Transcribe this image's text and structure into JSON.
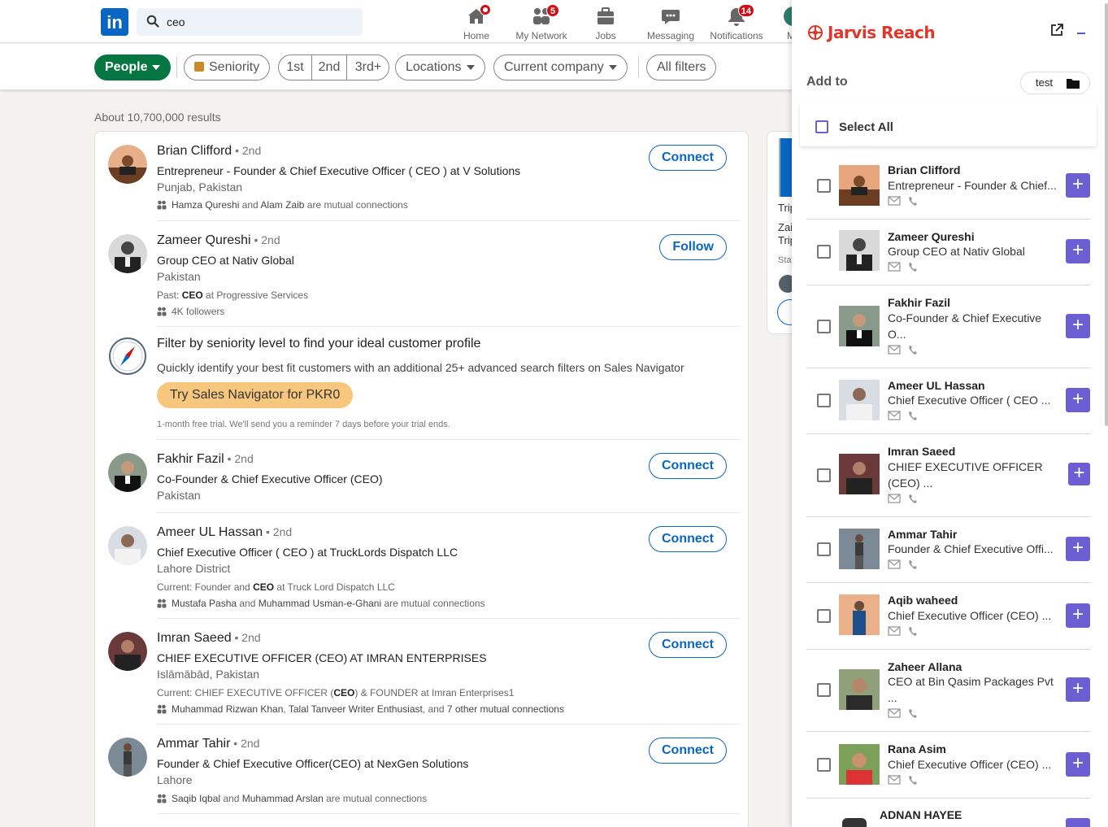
{
  "nav": {
    "search_value": "ceo",
    "items": [
      {
        "label": "Home",
        "icon": "home-icon",
        "badge": ""
      },
      {
        "label": "My Network",
        "icon": "network-icon",
        "badge": "5"
      },
      {
        "label": "Jobs",
        "icon": "briefcase-icon",
        "badge": ""
      },
      {
        "label": "Messaging",
        "icon": "messaging-icon",
        "badge": ""
      },
      {
        "label": "Notifications",
        "icon": "bell-icon",
        "badge": "14"
      }
    ],
    "cut_label": "M"
  },
  "filters": {
    "people": "People",
    "seniority": "Seniority",
    "deg1": "1st",
    "deg2": "2nd",
    "deg3": "3rd+",
    "locations": "Locations",
    "current_company": "Current company",
    "all_filters": "All filters"
  },
  "results": {
    "count": "About 10,700,000 results",
    "items": [
      {
        "name": "Brian Clifford",
        "degree": " • 2nd",
        "headline": "Entrepreneur - Founder & Chief Executive Officer ( CEO ) at V Solutions",
        "location": "Punjab, Pakistan",
        "extra": "",
        "mutual_a": "Hamza Qureshi",
        "mutual_mid": " and ",
        "mutual_b": "Alam Zaib",
        "mutual_end": " are mutual connections",
        "action": "Connect"
      },
      {
        "name": "Zameer Qureshi",
        "degree": " • 2nd",
        "headline": "Group CEO at Nativ Global",
        "location": "Pakistan",
        "past_pre": "Past: ",
        "past_bold": "CEO",
        "past_post": " at Progressive Services",
        "followers": "4K followers",
        "action": "Follow"
      },
      {
        "name": "Fakhir Fazil",
        "degree": " • 2nd",
        "headline": "Co-Founder & Chief Executive Officer (CEO)",
        "location": "Pakistan",
        "action": "Connect"
      },
      {
        "name": "Ameer UL Hassan",
        "degree": " • 2nd",
        "headline": "Chief Executive Officer ( CEO ) at TruckLords Dispatch LLC",
        "location": "Lahore District",
        "cur_pre": "Current: Founder and ",
        "cur_bold": "CEO",
        "cur_post": " at Truck Lord Dispatch LLC",
        "mutual_a": "Mustafa Pasha",
        "mutual_mid": " and ",
        "mutual_b": "Muhammad Usman-e-Ghani",
        "mutual_end": " are mutual connections",
        "action": "Connect"
      },
      {
        "name": "Imran Saeed",
        "degree": " • 2nd",
        "headline": "CHIEF EXECUTIVE OFFICER (CEO) AT IMRAN ENTERPRISES",
        "location": "Islāmābād, Pakistan",
        "cur_pre": "Current: CHIEF EXECUTIVE OFFICER (",
        "cur_bold": "CEO",
        "cur_post": ") & FOUNDER at Imran Enterprises1",
        "mutual_a": "Muhammad Rizwan Khan",
        "mutual_mid": ", ",
        "mutual_b": "Talal Tanveer Writer Enthusiast",
        "mutual_end": ", and ",
        "mutual_c": "7 other mutual connections",
        "action": "Connect"
      },
      {
        "name": "Ammar Tahir",
        "degree": " • 2nd",
        "headline": "Founder & Chief Executive Officer(CEO) at NexGen Solutions",
        "location": "Lahore",
        "mutual_a": "Saqib Iqbal",
        "mutual_mid": " and ",
        "mutual_b": "Muhammad Arslan",
        "mutual_end": " are mutual connections",
        "action": "Connect"
      }
    ],
    "promo": {
      "title": "Filter by seniority level to find your ideal customer profile",
      "desc": "Quickly identify your best fit customers with an additional 25+ advanced search filters on Sales Navigator",
      "button": "Try Sales Navigator for PKR0",
      "note": "1-month free trial. We'll send you a reminder 7 days before your trial ends."
    }
  },
  "ad": {
    "line1": "Trip",
    "line2": "Zaib",
    "line3": "Trip",
    "line4": "Stay"
  },
  "jarvis": {
    "brand": "Jarvis Reach",
    "add_to": "Add to",
    "folder": "test",
    "select_all": "Select All",
    "people": [
      {
        "name": "Brian Clifford",
        "title": "Entrepreneur - Founder & Chief..."
      },
      {
        "name": "Zameer Qureshi",
        "title": "Group CEO at Nativ Global"
      },
      {
        "name": "Fakhir Fazil",
        "title": "Co-Founder & Chief Executive O..."
      },
      {
        "name": "Ameer UL Hassan",
        "title": "Chief Executive Officer ( CEO ..."
      },
      {
        "name": "Imran Saeed",
        "title": "CHIEF EXECUTIVE OFFICER (CEO) ..."
      },
      {
        "name": "Ammar Tahir",
        "title": "Founder & Chief Executive Offi..."
      },
      {
        "name": "Aqib waheed",
        "title": "Chief Executive Officer (CEO) ..."
      },
      {
        "name": "Zaheer Allana",
        "title": "CEO at Bin Qasim Packages Pvt ..."
      },
      {
        "name": "Rana Asim",
        "title": "Chief Executive Officer (CEO) ..."
      },
      {
        "name": "ADNAN HAYEE",
        "title": ""
      }
    ]
  },
  "colors": {
    "linkedin_blue": "#0a66c2",
    "people_green": "#057642",
    "jarvis_purple": "#6b5fd3",
    "jarvis_red": "#e0362b",
    "badge_red": "#cc1016"
  }
}
